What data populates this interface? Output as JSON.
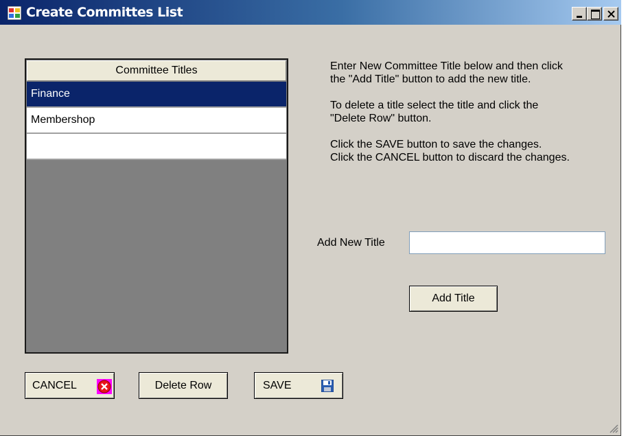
{
  "window": {
    "title": "Create Committes List",
    "icons": {
      "app": "app-window-icon",
      "minimize": "minimize-icon",
      "maximize": "maximize-icon",
      "close": "close-icon"
    }
  },
  "grid": {
    "header": "Committee Titles",
    "rows": [
      {
        "title": "Finance",
        "selected": true
      },
      {
        "title": "Membershop",
        "selected": false
      },
      {
        "title": "",
        "selected": false
      }
    ]
  },
  "instructions": {
    "para1_line1": "Enter New Committee Title below and then click",
    "para1_line2": "the \"Add Title\" button to add the new title.",
    "para2_line1": "To delete a title select the title and click the",
    "para2_line2": "\"Delete Row\" button.",
    "para3_line1": "Click the SAVE button to save the changes.",
    "para3_line2": "Click the CANCEL button to discard the changes."
  },
  "form": {
    "add_label": "Add New Title",
    "add_value": "",
    "add_button": "Add Title"
  },
  "buttons": {
    "cancel": "CANCEL",
    "delete": "Delete Row",
    "save": "SAVE",
    "cancel_icon": "cancel-x-icon",
    "save_icon": "floppy-disk-icon"
  },
  "colors": {
    "window_bg": "#d4d0c8",
    "selection": "#0a246a",
    "grid_bg": "#808080"
  }
}
